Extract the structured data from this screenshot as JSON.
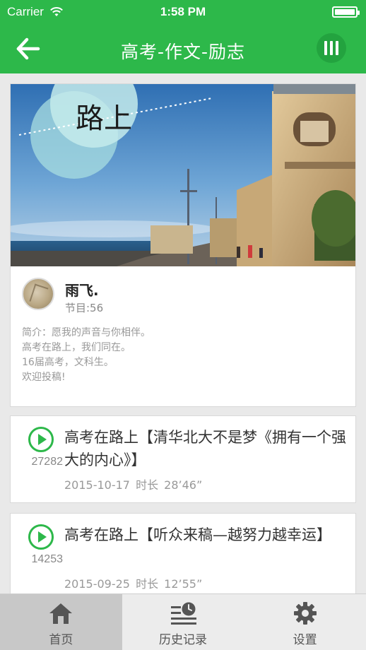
{
  "status_bar": {
    "carrier": "Carrier",
    "time": "1:58 PM",
    "wifi_icon": "wifi-icon",
    "battery_icon": "battery-icon"
  },
  "nav": {
    "title": "高考-作文-励志",
    "back_icon": "arrow-left-icon",
    "player_icon": "equalizer-icon",
    "color": "#2db84a"
  },
  "profile": {
    "cover_text": "路上",
    "name": "雨飞.",
    "episode_count": "节目:56",
    "bio": "简介：愿我的声音与你相伴。\n高考在路上，我们同在。\n16届高考，文科生。\n欢迎投稿!"
  },
  "episodes": [
    {
      "play_count": "27282",
      "title": "高考在路上【清华北大不是梦《拥有一个强大的内心》】",
      "date": "2015-10-17",
      "duration": "时长 28’46”"
    },
    {
      "play_count": "14253",
      "title": "高考在路上【听众来稿—越努力越幸运】",
      "date": "2015-09-25",
      "duration": "时长 12’55”"
    }
  ],
  "tabs": [
    {
      "label": "首页",
      "icon": "home-icon",
      "active": true
    },
    {
      "label": "历史记录",
      "icon": "history-icon",
      "active": false
    },
    {
      "label": "设置",
      "icon": "gear-icon",
      "active": false
    }
  ]
}
